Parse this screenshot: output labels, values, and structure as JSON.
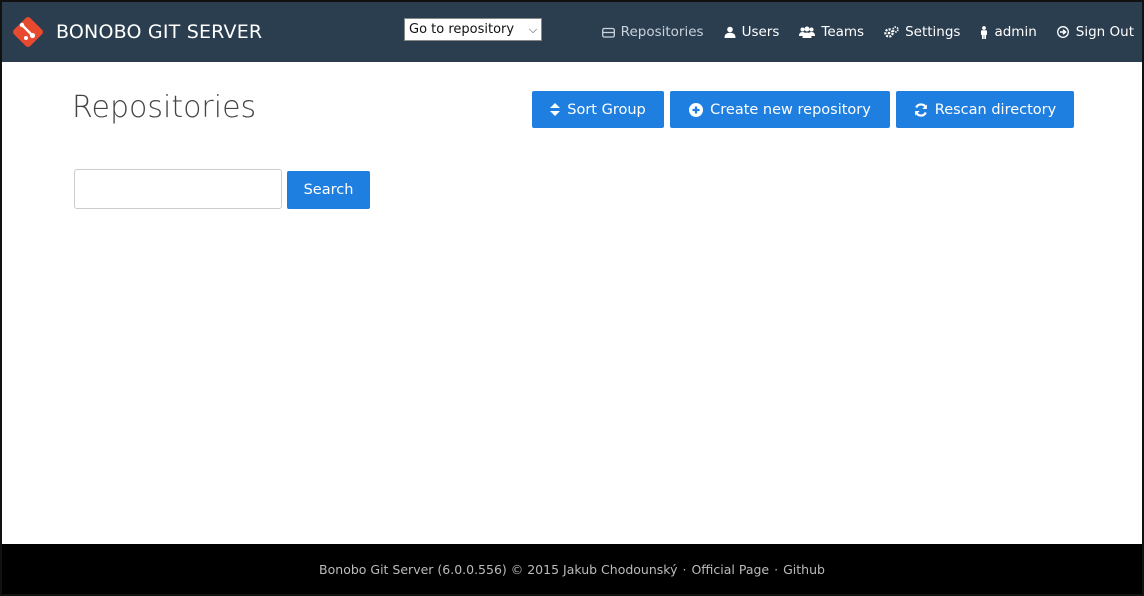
{
  "navbar": {
    "brand": "BONOBO GIT SERVER",
    "repo_select": {
      "selected": "Go to repository"
    },
    "items": [
      {
        "label": "Repositories",
        "icon": "repository-icon",
        "active": true
      },
      {
        "label": "Users",
        "icon": "user-icon"
      },
      {
        "label": "Teams",
        "icon": "team-icon"
      },
      {
        "label": "Settings",
        "icon": "gears-icon"
      },
      {
        "label": "admin",
        "icon": "person-icon"
      },
      {
        "label": "Sign Out",
        "icon": "sign-out-icon"
      }
    ]
  },
  "main": {
    "title": "Repositories",
    "buttons": {
      "sort": "Sort Group",
      "create": "Create new repository",
      "rescan": "Rescan directory"
    },
    "search": {
      "value": "",
      "button": "Search"
    }
  },
  "footer": {
    "text": "Bonobo Git Server (6.0.0.556) © 2015 Jakub Chodounský",
    "official_link": "Official Page",
    "github_link": "Github",
    "separator": "·"
  },
  "colors": {
    "navbar_bg": "#2b3e50",
    "primary": "#1f7fe0",
    "logo": "#e84a2f",
    "footer_bg": "#000000"
  }
}
